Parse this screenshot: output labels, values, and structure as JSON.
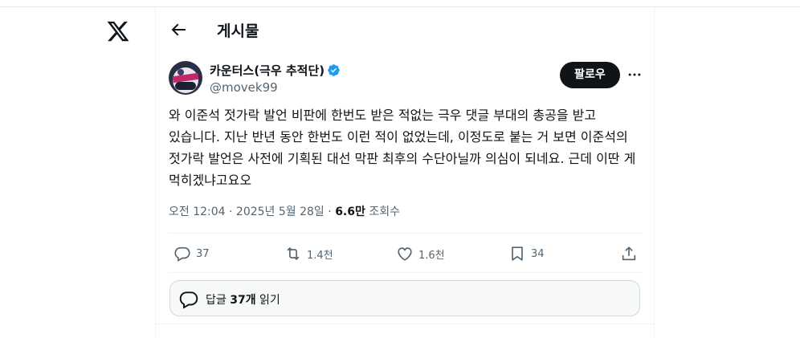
{
  "header": {
    "title": "게시물"
  },
  "author": {
    "name": "카운터스(극우 추적단)",
    "handle": "@movek99",
    "verified": true
  },
  "follow_label": "팔로우",
  "tweet": {
    "text": "와 이준석 젓가락 발언 비판에 한번도 받은 적없는 극우 댓글 부대의 총공을 받고 있습니다. 지난 반년 동안 한번도 이런 적이 없었는데, 이정도로 붙는 거 보면 이준석의 젓가락 발언은 사전에 기획된 대선 막판 최후의 수단아닐까 의심이 되네요. 근데 이딴 게 먹히겠냐고요오",
    "time": "오전 12:04",
    "date": "2025년 5월 28일",
    "separator": "·",
    "views_count": "6.6만",
    "views_label": "조회수"
  },
  "actions": {
    "replies": "37",
    "retweets": "1.4천",
    "likes": "1.6천",
    "bookmarks": "34"
  },
  "read_replies": {
    "prefix": "답글",
    "count": "37개",
    "suffix": "읽기"
  },
  "colors": {
    "text": "#0f1419",
    "muted": "#536471",
    "verified_blue": "#1d9bf0",
    "border": "#cfd9de"
  }
}
